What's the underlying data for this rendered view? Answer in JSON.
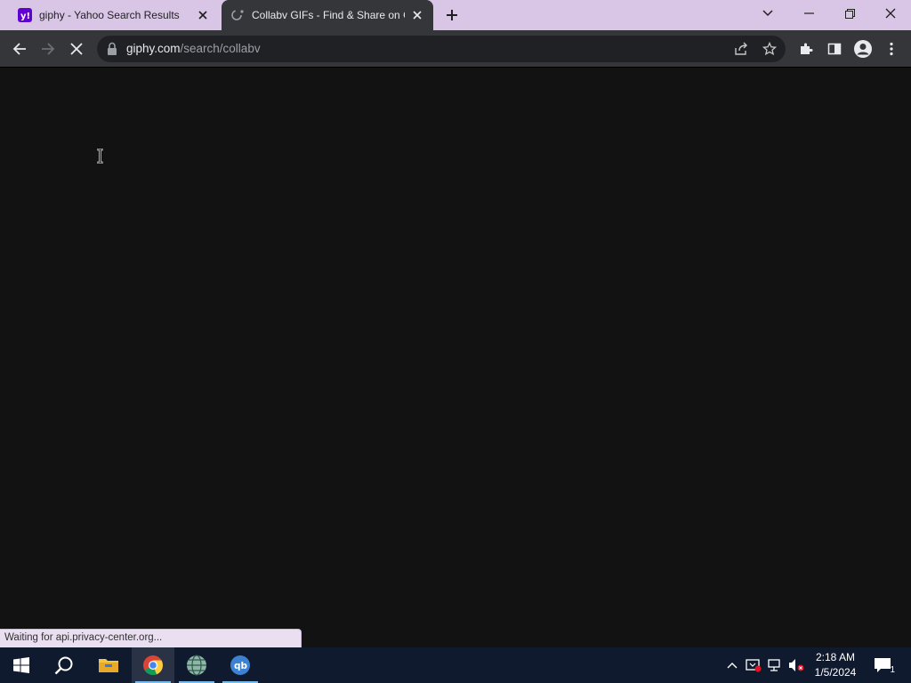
{
  "browser": {
    "tabs": [
      {
        "title": "giphy - Yahoo Search Results",
        "favicon": "yahoo-icon",
        "active": false
      },
      {
        "title": "Collabv GIFs - Find & Share on GIPHY",
        "favicon": "giphy-loading-icon",
        "active": true
      }
    ],
    "address": {
      "host": "giphy.com",
      "path": "/search/collabv"
    },
    "status_text": "Waiting for api.privacy-center.org...",
    "colors": {
      "tabstrip": "#d9c6e7",
      "toolbar": "#35363a",
      "omnibox": "#202124",
      "content": "#121212",
      "status": "#e9dff1"
    }
  },
  "taskbar": {
    "apps": [
      "windows-start-icon",
      "search-icon",
      "file-explorer-icon",
      "chrome-icon",
      "network-app-icon",
      "qbittorrent-icon"
    ],
    "qb_label": "qb",
    "clock": {
      "time": "2:18 AM",
      "date": "1/5/2024"
    },
    "notification_count": "1",
    "color": "#0f1a2e"
  }
}
